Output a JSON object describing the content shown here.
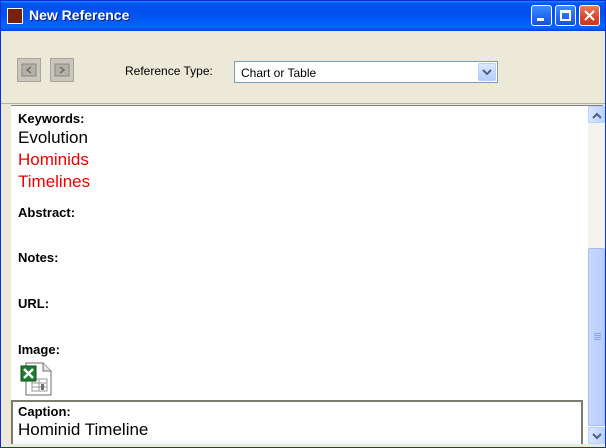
{
  "window": {
    "title": "New Reference"
  },
  "toolbar": {
    "reference_type_label": "Reference Type:",
    "reference_type_value": "Chart or Table"
  },
  "fields": {
    "keywords_label": "Keywords:",
    "keywords": [
      {
        "text": "Evolution",
        "color": "#000000"
      },
      {
        "text": "Hominids",
        "color": "#ee0000"
      },
      {
        "text": "Timelines",
        "color": "#ee0000"
      }
    ],
    "abstract_label": "Abstract:",
    "notes_label": "Notes:",
    "url_label": "URL:",
    "image_label": "Image:",
    "image_icon": "excel-file-icon",
    "caption_label": "Caption:",
    "caption_value": "Hominid Timeline"
  },
  "colors": {
    "title_bar": "#0053ee",
    "red_text": "#ee0000"
  }
}
